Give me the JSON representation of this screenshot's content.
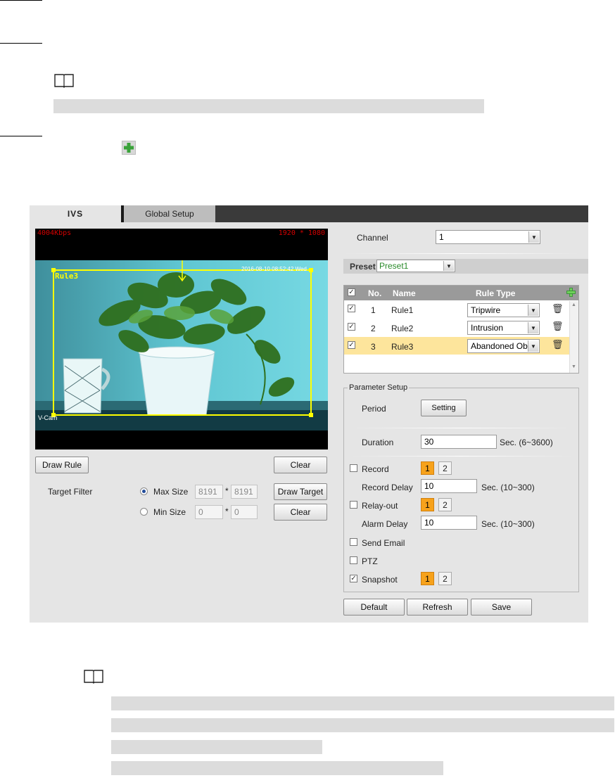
{
  "window": {
    "tabs": [
      {
        "label": "IVS"
      },
      {
        "label": "Global Setup"
      }
    ]
  },
  "video": {
    "bitrate": "4004Kbps",
    "resolution": "1920 * 1080",
    "timestamp": "2016-08-10 08:52:42 Wed",
    "rule_label": "Rule3",
    "channel_label": "V-Cam"
  },
  "left_controls": {
    "draw_rule": "Draw Rule",
    "clear": "Clear",
    "target_filter": "Target Filter",
    "max_size_label": "Max Size",
    "min_size_label": "Min Size",
    "max_w": "8191",
    "max_h": "8191",
    "min_w": "0",
    "min_h": "0",
    "times": "*",
    "draw_target": "Draw Target",
    "clear2": "Clear"
  },
  "channel": {
    "label": "Channel",
    "value": "1"
  },
  "preset": {
    "label": "Preset",
    "value": "Preset1"
  },
  "rules": {
    "headers": {
      "no": "No.",
      "name": "Name",
      "type": "Rule Type"
    },
    "rows": [
      {
        "no": "1",
        "name": "Rule1",
        "type": "Tripwire",
        "checked": true
      },
      {
        "no": "2",
        "name": "Rule2",
        "type": "Intrusion",
        "checked": true
      },
      {
        "no": "3",
        "name": "Rule3",
        "type": "Abandoned Ob",
        "checked": true
      }
    ]
  },
  "params": {
    "legend": "Parameter Setup",
    "period": "Period",
    "setting": "Setting",
    "duration": "Duration",
    "duration_value": "30",
    "duration_range": "Sec. (6~3600)",
    "record": "Record",
    "record_delay": "Record Delay",
    "record_delay_value": "10",
    "delay_range": "Sec. (10~300)",
    "relay_out": "Relay-out",
    "alarm_delay": "Alarm Delay",
    "alarm_delay_value": "10",
    "alarm_range": "Sec. (10~300)",
    "send_email": "Send Email",
    "ptz": "PTZ",
    "snapshot": "Snapshot",
    "one": "1",
    "two": "2",
    "check": "✓"
  },
  "footer": {
    "default": "Default",
    "refresh": "Refresh",
    "save": "Save"
  },
  "colors": {
    "accent_orange": "#f7a21b",
    "selected_row": "#fde59c",
    "tab_bar": "#3a3a3a",
    "rule_yellow": "#ffff00"
  }
}
